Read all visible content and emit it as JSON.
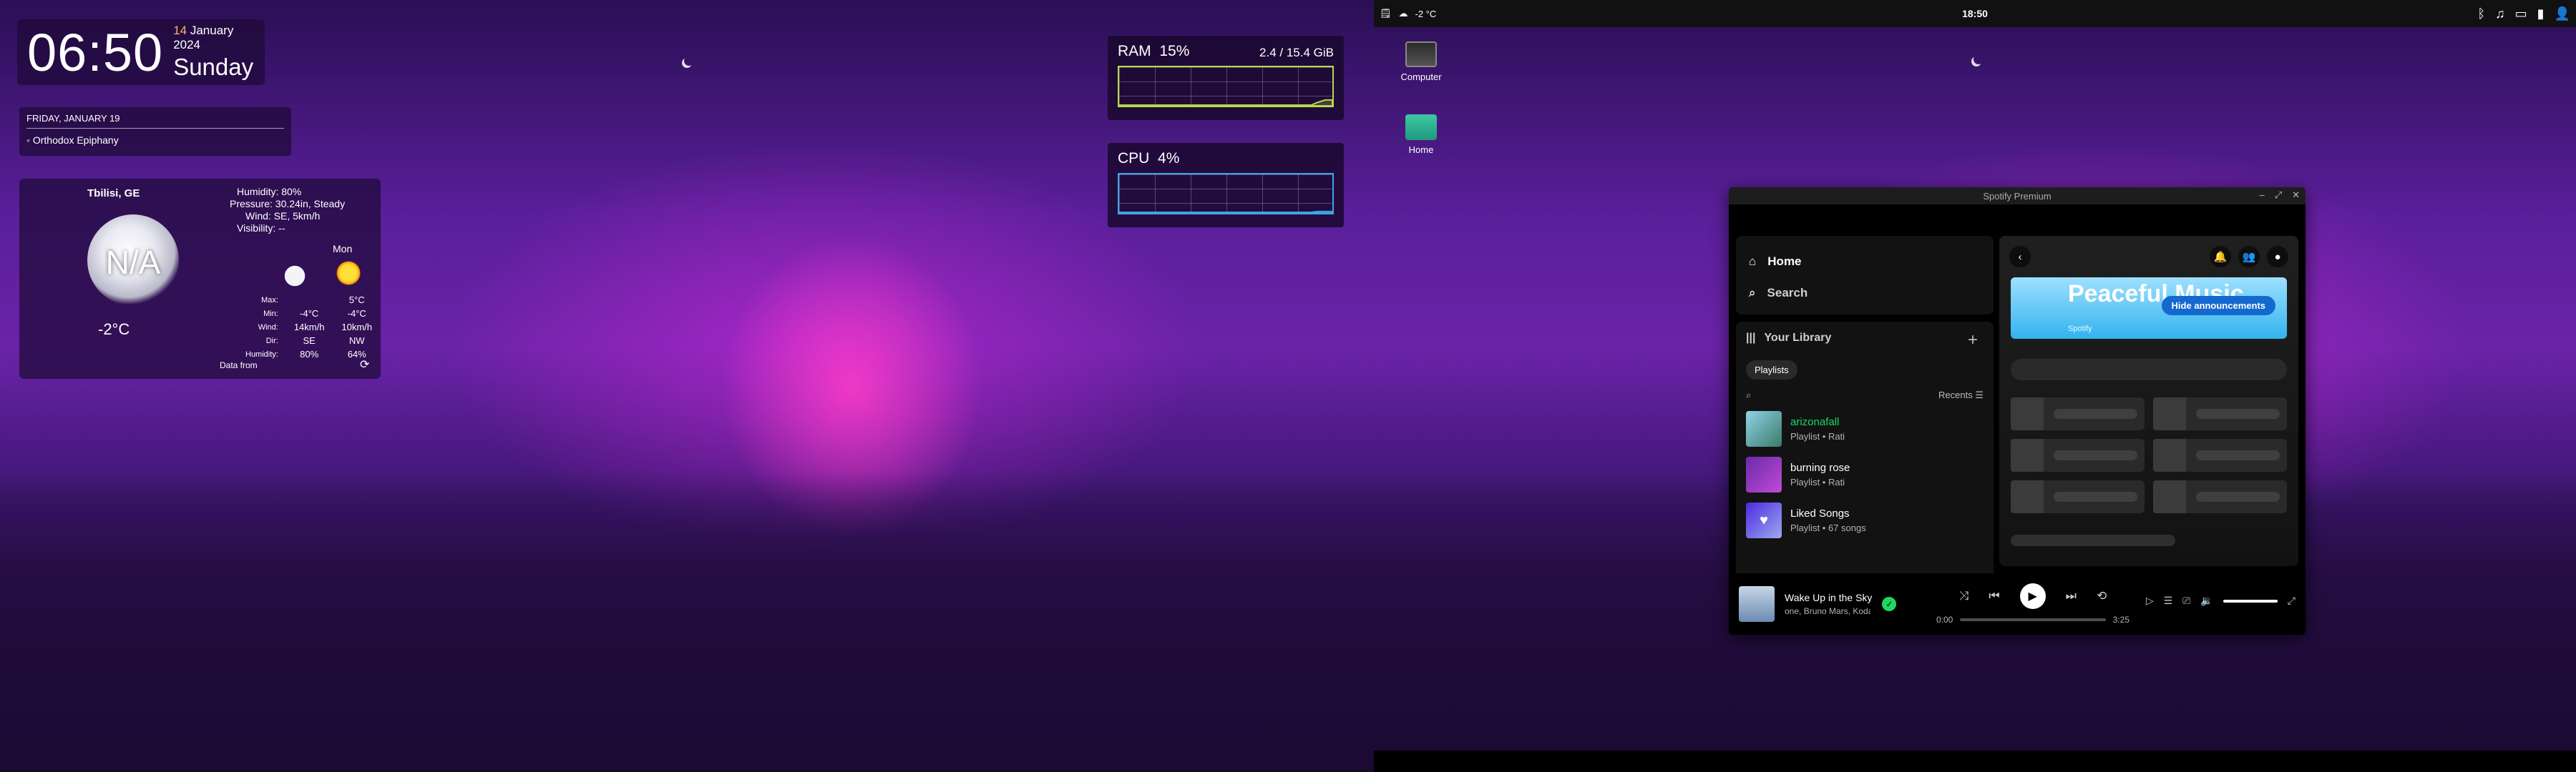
{
  "clock": {
    "time": "06:50",
    "day_num": "14",
    "month_year": "January 2024",
    "weekday": "Sunday"
  },
  "events": {
    "header": "FRIDAY, JANUARY 19",
    "items": [
      "◦ Orthodox Epiphany"
    ]
  },
  "weather": {
    "city": "Tbilisi, GE",
    "current": "N/A",
    "temp": "-2°C",
    "details": [
      "Humidity: 80%",
      "Pressure: 30.24in, Steady",
      "Wind: SE, 5km/h",
      "Visibility: --"
    ],
    "forecast_day": "Mon",
    "forecast_temp": "5°C",
    "table": {
      "labels": [
        "Max:",
        "Min:",
        "Wind:",
        "Dir:",
        "Humidity:"
      ],
      "today": [
        "",
        "-4°C",
        "14km/h",
        "SE",
        "80%"
      ],
      "mon": [
        "5°C",
        "-4°C",
        "10km/h",
        "NW",
        "64%"
      ]
    },
    "data_from": "Data from",
    "refresh_icon": "refresh-icon"
  },
  "ram": {
    "label": "RAM",
    "percent": "15%",
    "info": "2.4 / 15.4 GiB",
    "usage_fraction": 0.15,
    "color": "#b5d94a"
  },
  "cpu": {
    "label": "CPU",
    "percent": "4%",
    "usage_fraction": 0.04,
    "color": "#3aa7e6"
  },
  "panel": {
    "weather": "-2 °C",
    "clock": "18:50",
    "icons": [
      "bluetooth-icon",
      "music-icon",
      "monitor-icon",
      "battery-icon",
      "user-icon"
    ]
  },
  "desktop": {
    "icons": [
      "Computer",
      "Home"
    ]
  },
  "spotify": {
    "title": "Spotify Premium",
    "nav": {
      "home": "Home",
      "search": "Search"
    },
    "library": {
      "title": "Your Library",
      "chip": "Playlists",
      "sort": "Recents",
      "playlists": [
        {
          "name": "arizonafall",
          "meta": "Playlist • Rati",
          "highlight": true,
          "color": "#1ed760"
        },
        {
          "name": "burning rose",
          "meta": "Playlist • Rati",
          "highlight": false,
          "color": "#ffffff"
        },
        {
          "name": "Liked Songs",
          "meta": "Playlist • 67 songs",
          "highlight": false,
          "color": "#ffffff"
        }
      ]
    },
    "banner": {
      "title": "Peaceful Music",
      "hide_button": "Hide announcements",
      "brand": "Spotify"
    },
    "player": {
      "song": "Wake Up in the Sky",
      "artist": "one, Bruno Mars, Kodak B",
      "elapsed": "0:00",
      "duration": "3:25",
      "progress": 0
    }
  }
}
